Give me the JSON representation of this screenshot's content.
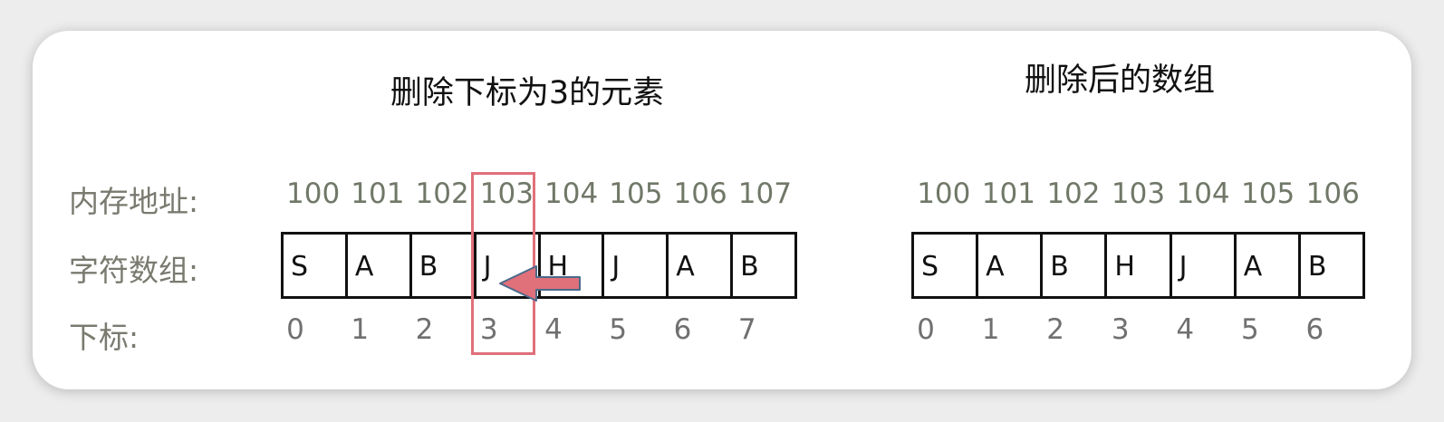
{
  "left": {
    "title": "删除下标为3的元素",
    "addresses": [
      "100",
      "101",
      "102",
      "103",
      "104",
      "105",
      "106",
      "107"
    ],
    "chars": [
      "S",
      "A",
      "B",
      "J",
      "H",
      "J",
      "A",
      "B"
    ],
    "indices": [
      "0",
      "1",
      "2",
      "3",
      "4",
      "5",
      "6",
      "7"
    ]
  },
  "right": {
    "title": "删除后的数组",
    "addresses": [
      "100",
      "101",
      "102",
      "103",
      "104",
      "105",
      "106"
    ],
    "chars": [
      "S",
      "A",
      "B",
      "H",
      "J",
      "A",
      "B"
    ],
    "indices": [
      "0",
      "1",
      "2",
      "3",
      "4",
      "5",
      "6"
    ]
  },
  "labels": {
    "memory": "内存地址:",
    "chars": "字符数组:",
    "index": "下标:"
  },
  "highlight": {
    "index": 3,
    "color": "#e0707a"
  },
  "arrow": {
    "fill": "#e0707a",
    "stroke": "#4a6a8a",
    "direction": "left"
  }
}
